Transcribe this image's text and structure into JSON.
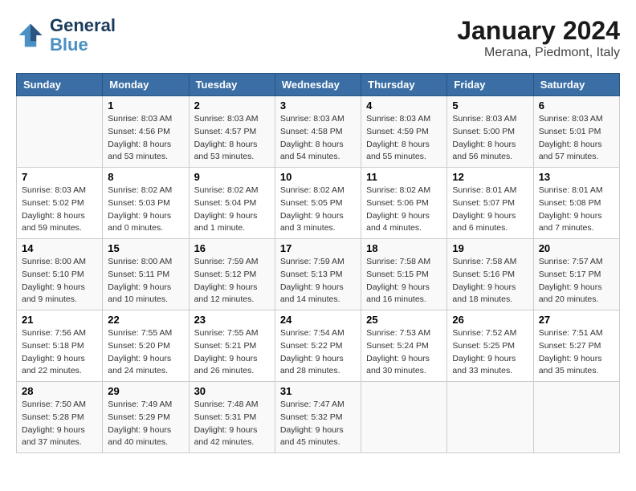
{
  "header": {
    "logo_line1": "General",
    "logo_line2": "Blue",
    "main_title": "January 2024",
    "subtitle": "Merana, Piedmont, Italy"
  },
  "days_of_week": [
    "Sunday",
    "Monday",
    "Tuesday",
    "Wednesday",
    "Thursday",
    "Friday",
    "Saturday"
  ],
  "weeks": [
    [
      {
        "day": "",
        "info": ""
      },
      {
        "day": "1",
        "info": "Sunrise: 8:03 AM\nSunset: 4:56 PM\nDaylight: 8 hours\nand 53 minutes."
      },
      {
        "day": "2",
        "info": "Sunrise: 8:03 AM\nSunset: 4:57 PM\nDaylight: 8 hours\nand 53 minutes."
      },
      {
        "day": "3",
        "info": "Sunrise: 8:03 AM\nSunset: 4:58 PM\nDaylight: 8 hours\nand 54 minutes."
      },
      {
        "day": "4",
        "info": "Sunrise: 8:03 AM\nSunset: 4:59 PM\nDaylight: 8 hours\nand 55 minutes."
      },
      {
        "day": "5",
        "info": "Sunrise: 8:03 AM\nSunset: 5:00 PM\nDaylight: 8 hours\nand 56 minutes."
      },
      {
        "day": "6",
        "info": "Sunrise: 8:03 AM\nSunset: 5:01 PM\nDaylight: 8 hours\nand 57 minutes."
      }
    ],
    [
      {
        "day": "7",
        "info": "Sunrise: 8:03 AM\nSunset: 5:02 PM\nDaylight: 8 hours\nand 59 minutes."
      },
      {
        "day": "8",
        "info": "Sunrise: 8:02 AM\nSunset: 5:03 PM\nDaylight: 9 hours\nand 0 minutes."
      },
      {
        "day": "9",
        "info": "Sunrise: 8:02 AM\nSunset: 5:04 PM\nDaylight: 9 hours\nand 1 minute."
      },
      {
        "day": "10",
        "info": "Sunrise: 8:02 AM\nSunset: 5:05 PM\nDaylight: 9 hours\nand 3 minutes."
      },
      {
        "day": "11",
        "info": "Sunrise: 8:02 AM\nSunset: 5:06 PM\nDaylight: 9 hours\nand 4 minutes."
      },
      {
        "day": "12",
        "info": "Sunrise: 8:01 AM\nSunset: 5:07 PM\nDaylight: 9 hours\nand 6 minutes."
      },
      {
        "day": "13",
        "info": "Sunrise: 8:01 AM\nSunset: 5:08 PM\nDaylight: 9 hours\nand 7 minutes."
      }
    ],
    [
      {
        "day": "14",
        "info": "Sunrise: 8:00 AM\nSunset: 5:10 PM\nDaylight: 9 hours\nand 9 minutes."
      },
      {
        "day": "15",
        "info": "Sunrise: 8:00 AM\nSunset: 5:11 PM\nDaylight: 9 hours\nand 10 minutes."
      },
      {
        "day": "16",
        "info": "Sunrise: 7:59 AM\nSunset: 5:12 PM\nDaylight: 9 hours\nand 12 minutes."
      },
      {
        "day": "17",
        "info": "Sunrise: 7:59 AM\nSunset: 5:13 PM\nDaylight: 9 hours\nand 14 minutes."
      },
      {
        "day": "18",
        "info": "Sunrise: 7:58 AM\nSunset: 5:15 PM\nDaylight: 9 hours\nand 16 minutes."
      },
      {
        "day": "19",
        "info": "Sunrise: 7:58 AM\nSunset: 5:16 PM\nDaylight: 9 hours\nand 18 minutes."
      },
      {
        "day": "20",
        "info": "Sunrise: 7:57 AM\nSunset: 5:17 PM\nDaylight: 9 hours\nand 20 minutes."
      }
    ],
    [
      {
        "day": "21",
        "info": "Sunrise: 7:56 AM\nSunset: 5:18 PM\nDaylight: 9 hours\nand 22 minutes."
      },
      {
        "day": "22",
        "info": "Sunrise: 7:55 AM\nSunset: 5:20 PM\nDaylight: 9 hours\nand 24 minutes."
      },
      {
        "day": "23",
        "info": "Sunrise: 7:55 AM\nSunset: 5:21 PM\nDaylight: 9 hours\nand 26 minutes."
      },
      {
        "day": "24",
        "info": "Sunrise: 7:54 AM\nSunset: 5:22 PM\nDaylight: 9 hours\nand 28 minutes."
      },
      {
        "day": "25",
        "info": "Sunrise: 7:53 AM\nSunset: 5:24 PM\nDaylight: 9 hours\nand 30 minutes."
      },
      {
        "day": "26",
        "info": "Sunrise: 7:52 AM\nSunset: 5:25 PM\nDaylight: 9 hours\nand 33 minutes."
      },
      {
        "day": "27",
        "info": "Sunrise: 7:51 AM\nSunset: 5:27 PM\nDaylight: 9 hours\nand 35 minutes."
      }
    ],
    [
      {
        "day": "28",
        "info": "Sunrise: 7:50 AM\nSunset: 5:28 PM\nDaylight: 9 hours\nand 37 minutes."
      },
      {
        "day": "29",
        "info": "Sunrise: 7:49 AM\nSunset: 5:29 PM\nDaylight: 9 hours\nand 40 minutes."
      },
      {
        "day": "30",
        "info": "Sunrise: 7:48 AM\nSunset: 5:31 PM\nDaylight: 9 hours\nand 42 minutes."
      },
      {
        "day": "31",
        "info": "Sunrise: 7:47 AM\nSunset: 5:32 PM\nDaylight: 9 hours\nand 45 minutes."
      },
      {
        "day": "",
        "info": ""
      },
      {
        "day": "",
        "info": ""
      },
      {
        "day": "",
        "info": ""
      }
    ]
  ]
}
